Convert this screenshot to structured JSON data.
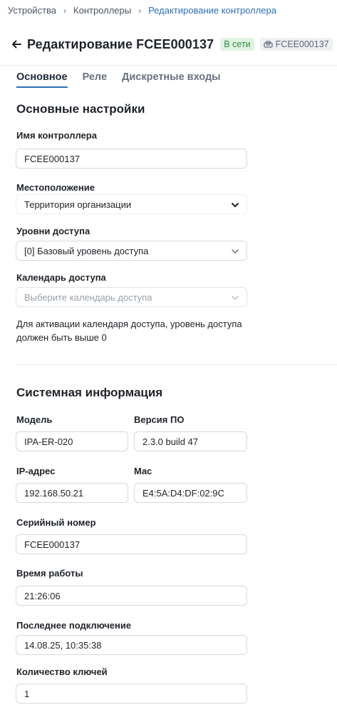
{
  "breadcrumb": {
    "items": [
      "Устройства",
      "Контроллеры",
      "Редактирование контроллера"
    ]
  },
  "header": {
    "title": "Редактирование FCEE000137",
    "status": "В сети",
    "serial": "FCEE000137"
  },
  "tabs": [
    "Основное",
    "Реле",
    "Дискретные входы"
  ],
  "basic": {
    "title": "Основные настройки",
    "name_label": "Имя контроллера",
    "name_value": "FCEE000137",
    "location_label": "Местоположение",
    "location_value": "Территория организации",
    "access_level_label": "Уровни доступа",
    "access_level_value": "[0] Базовый уровень доступа",
    "calendar_label": "Календарь доступа",
    "calendar_placeholder": "Выберите календарь доступа",
    "calendar_hint": "Для активации календаря доступа, уровень доступа должен быть выше 0"
  },
  "system": {
    "title": "Системная информация",
    "model_label": "Модель",
    "model_value": "IPA-ER-020",
    "firmware_label": "Версия ПО",
    "firmware_value": "2.3.0 build 47",
    "ip_label": "IP-адрес",
    "ip_value": "192.168.50.21",
    "mac_label": "Mac",
    "mac_value": "E4:5A:D4:DF:02:9C",
    "serial_label": "Серийный номер",
    "serial_value": "FCEE000137",
    "uptime_label": "Время работы",
    "uptime_value": "21:26:06",
    "last_conn_label": "Последнее подключение",
    "last_conn_value": "14.08.25, 10:35:38",
    "keys_label": "Количество ключей",
    "keys_value": "1"
  },
  "colors": {
    "accent": "#2f6fb3",
    "online_bg": "#dff3e3",
    "online_text": "#2f8a43"
  }
}
